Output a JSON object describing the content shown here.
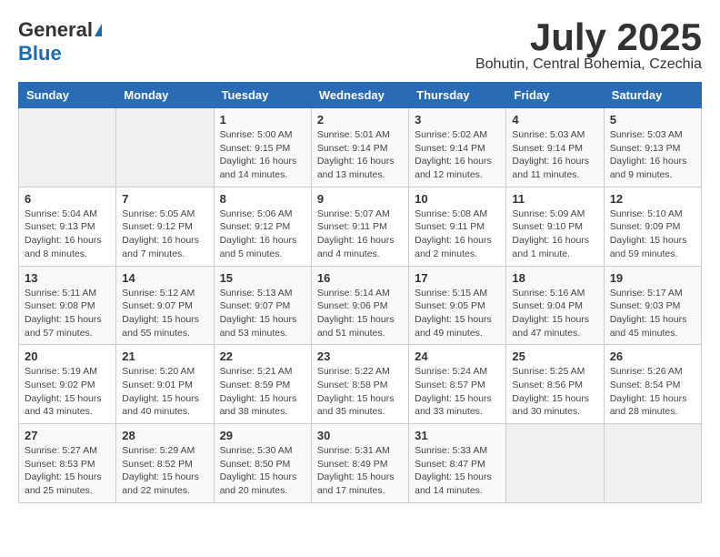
{
  "header": {
    "logo_general": "General",
    "logo_blue": "Blue",
    "month_title": "July 2025",
    "location": "Bohutin, Central Bohemia, Czechia"
  },
  "weekdays": [
    "Sunday",
    "Monday",
    "Tuesday",
    "Wednesday",
    "Thursday",
    "Friday",
    "Saturday"
  ],
  "weeks": [
    [
      {
        "day": "",
        "info": ""
      },
      {
        "day": "",
        "info": ""
      },
      {
        "day": "1",
        "info": "Sunrise: 5:00 AM\nSunset: 9:15 PM\nDaylight: 16 hours\nand 14 minutes."
      },
      {
        "day": "2",
        "info": "Sunrise: 5:01 AM\nSunset: 9:14 PM\nDaylight: 16 hours\nand 13 minutes."
      },
      {
        "day": "3",
        "info": "Sunrise: 5:02 AM\nSunset: 9:14 PM\nDaylight: 16 hours\nand 12 minutes."
      },
      {
        "day": "4",
        "info": "Sunrise: 5:03 AM\nSunset: 9:14 PM\nDaylight: 16 hours\nand 11 minutes."
      },
      {
        "day": "5",
        "info": "Sunrise: 5:03 AM\nSunset: 9:13 PM\nDaylight: 16 hours\nand 9 minutes."
      }
    ],
    [
      {
        "day": "6",
        "info": "Sunrise: 5:04 AM\nSunset: 9:13 PM\nDaylight: 16 hours\nand 8 minutes."
      },
      {
        "day": "7",
        "info": "Sunrise: 5:05 AM\nSunset: 9:12 PM\nDaylight: 16 hours\nand 7 minutes."
      },
      {
        "day": "8",
        "info": "Sunrise: 5:06 AM\nSunset: 9:12 PM\nDaylight: 16 hours\nand 5 minutes."
      },
      {
        "day": "9",
        "info": "Sunrise: 5:07 AM\nSunset: 9:11 PM\nDaylight: 16 hours\nand 4 minutes."
      },
      {
        "day": "10",
        "info": "Sunrise: 5:08 AM\nSunset: 9:11 PM\nDaylight: 16 hours\nand 2 minutes."
      },
      {
        "day": "11",
        "info": "Sunrise: 5:09 AM\nSunset: 9:10 PM\nDaylight: 16 hours\nand 1 minute."
      },
      {
        "day": "12",
        "info": "Sunrise: 5:10 AM\nSunset: 9:09 PM\nDaylight: 15 hours\nand 59 minutes."
      }
    ],
    [
      {
        "day": "13",
        "info": "Sunrise: 5:11 AM\nSunset: 9:08 PM\nDaylight: 15 hours\nand 57 minutes."
      },
      {
        "day": "14",
        "info": "Sunrise: 5:12 AM\nSunset: 9:07 PM\nDaylight: 15 hours\nand 55 minutes."
      },
      {
        "day": "15",
        "info": "Sunrise: 5:13 AM\nSunset: 9:07 PM\nDaylight: 15 hours\nand 53 minutes."
      },
      {
        "day": "16",
        "info": "Sunrise: 5:14 AM\nSunset: 9:06 PM\nDaylight: 15 hours\nand 51 minutes."
      },
      {
        "day": "17",
        "info": "Sunrise: 5:15 AM\nSunset: 9:05 PM\nDaylight: 15 hours\nand 49 minutes."
      },
      {
        "day": "18",
        "info": "Sunrise: 5:16 AM\nSunset: 9:04 PM\nDaylight: 15 hours\nand 47 minutes."
      },
      {
        "day": "19",
        "info": "Sunrise: 5:17 AM\nSunset: 9:03 PM\nDaylight: 15 hours\nand 45 minutes."
      }
    ],
    [
      {
        "day": "20",
        "info": "Sunrise: 5:19 AM\nSunset: 9:02 PM\nDaylight: 15 hours\nand 43 minutes."
      },
      {
        "day": "21",
        "info": "Sunrise: 5:20 AM\nSunset: 9:01 PM\nDaylight: 15 hours\nand 40 minutes."
      },
      {
        "day": "22",
        "info": "Sunrise: 5:21 AM\nSunset: 8:59 PM\nDaylight: 15 hours\nand 38 minutes."
      },
      {
        "day": "23",
        "info": "Sunrise: 5:22 AM\nSunset: 8:58 PM\nDaylight: 15 hours\nand 35 minutes."
      },
      {
        "day": "24",
        "info": "Sunrise: 5:24 AM\nSunset: 8:57 PM\nDaylight: 15 hours\nand 33 minutes."
      },
      {
        "day": "25",
        "info": "Sunrise: 5:25 AM\nSunset: 8:56 PM\nDaylight: 15 hours\nand 30 minutes."
      },
      {
        "day": "26",
        "info": "Sunrise: 5:26 AM\nSunset: 8:54 PM\nDaylight: 15 hours\nand 28 minutes."
      }
    ],
    [
      {
        "day": "27",
        "info": "Sunrise: 5:27 AM\nSunset: 8:53 PM\nDaylight: 15 hours\nand 25 minutes."
      },
      {
        "day": "28",
        "info": "Sunrise: 5:29 AM\nSunset: 8:52 PM\nDaylight: 15 hours\nand 22 minutes."
      },
      {
        "day": "29",
        "info": "Sunrise: 5:30 AM\nSunset: 8:50 PM\nDaylight: 15 hours\nand 20 minutes."
      },
      {
        "day": "30",
        "info": "Sunrise: 5:31 AM\nSunset: 8:49 PM\nDaylight: 15 hours\nand 17 minutes."
      },
      {
        "day": "31",
        "info": "Sunrise: 5:33 AM\nSunset: 8:47 PM\nDaylight: 15 hours\nand 14 minutes."
      },
      {
        "day": "",
        "info": ""
      },
      {
        "day": "",
        "info": ""
      }
    ]
  ]
}
